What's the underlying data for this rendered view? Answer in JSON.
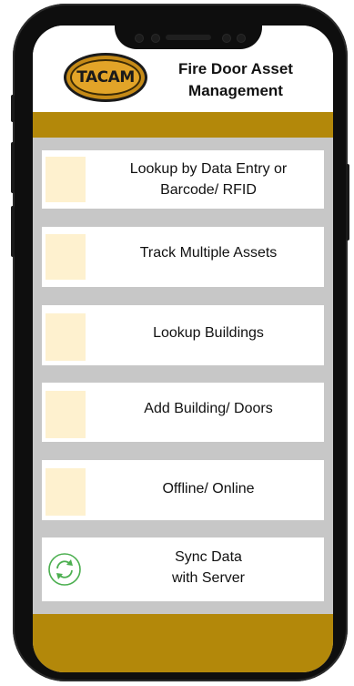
{
  "app": {
    "logo_text": "TACAM",
    "title_line1": "Fire Door Asset",
    "title_line2": "Management"
  },
  "menu": {
    "items": [
      {
        "label_line1": "Lookup by Data Entry or",
        "label_line2": "Barcode/ RFID",
        "icon": "placeholder-image"
      },
      {
        "label_line1": "Track Multiple Assets",
        "label_line2": "",
        "icon": "placeholder-image"
      },
      {
        "label_line1": "Lookup Buildings",
        "label_line2": "",
        "icon": "placeholder-image"
      },
      {
        "label_line1": "Add Building/ Doors",
        "label_line2": "",
        "icon": "placeholder-image"
      },
      {
        "label_line1": "Offline/ Online",
        "label_line2": "",
        "icon": "placeholder-image"
      },
      {
        "label_line1": "Sync Data",
        "label_line2": "with Server",
        "icon": "sync-icon"
      }
    ]
  },
  "colors": {
    "gold": "#b3880a",
    "thumb": "#fef1cf",
    "screen_bg": "#c7c7c7",
    "sync_icon": "#4caf50"
  }
}
